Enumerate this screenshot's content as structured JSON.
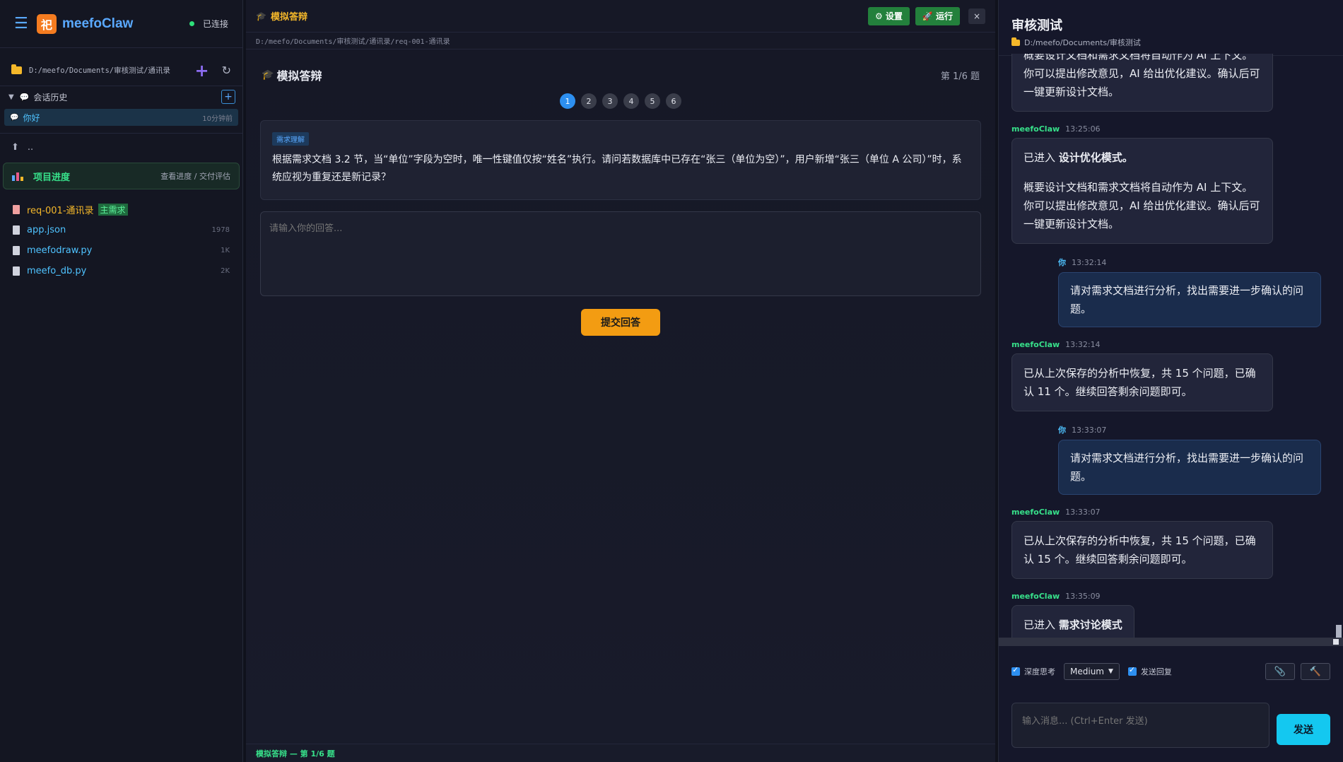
{
  "sidebar": {
    "brand": "meefoClaw",
    "logo_glyph": "祀",
    "connection_status": "已连接",
    "path": "D:/meefo/Documents/审核测试/通讯录",
    "history_label": "会话历史",
    "session": {
      "name": "你好",
      "time": "10分钟前"
    },
    "up_label": "..",
    "progress": {
      "title": "项目进度",
      "subtitle": "查看进度 / 交付评估"
    },
    "files": [
      {
        "name": "req-001-通讯录",
        "tag": "主需求",
        "size": ""
      },
      {
        "name": "app.json",
        "tag": "",
        "size": "1978"
      },
      {
        "name": "meefodraw.py",
        "tag": "",
        "size": "1K"
      },
      {
        "name": "meefo_db.py",
        "tag": "",
        "size": "2K"
      }
    ]
  },
  "center": {
    "header_title": "模拟答辩",
    "settings_label": "⚙ 设置",
    "run_label": "🚀 运行",
    "close_label": "×",
    "breadcrumb": "D:/meefo/Documents/审核测试/通讯录/req-001-通讯录",
    "question_title": "模拟答辩",
    "question_count": "第 1/6 题",
    "pages": [
      "1",
      "2",
      "3",
      "4",
      "5",
      "6"
    ],
    "question_tag": "需求理解",
    "question_text": "根据需求文档 3.2 节，当“单位”字段为空时，唯一性键值仅按“姓名”执行。请问若数据库中已存在“张三（单位为空）”，用户新增“张三（单位 A 公司）”时，系统应视为重复还是新记录？",
    "answer_placeholder": "请输入你的回答...",
    "submit_label": "提交回答",
    "footer_status": "模拟答辩 — 第 1/6 题"
  },
  "right": {
    "title": "审核测试",
    "path": "D:/meefo/Documents/审核测试",
    "messages": [
      {
        "who": "",
        "time": "",
        "text": "概要设计文档和需求文档将自动作为 AI 上下文。你可以提出修改意见，AI 给出优化建议。确认后可一键更新设计文档。"
      },
      {
        "who": "meefoClaw",
        "time": "13:25:06",
        "text_intro": "已进入 ",
        "text_bold": "设计优化模式。",
        "text": "概要设计文档和需求文档将自动作为 AI 上下文。你可以提出修改意见，AI 给出优化建议。确认后可一键更新设计文档。"
      },
      {
        "who": "你",
        "time": "13:32:14",
        "text": "请对需求文档进行分析，找出需要进一步确认的问题。"
      },
      {
        "who": "meefoClaw",
        "time": "13:32:14",
        "text": "已从上次保存的分析中恢复，共 15 个问题，已确认 11 个。继续回答剩余问题即可。"
      },
      {
        "who": "你",
        "time": "13:33:07",
        "text": "请对需求文档进行分析，找出需要进一步确认的问题。"
      },
      {
        "who": "meefoClaw",
        "time": "13:33:07",
        "text": "已从上次保存的分析中恢复，共 15 个问题，已确认 15 个。继续回答剩余问题即可。"
      },
      {
        "who": "meefoClaw",
        "time": "13:35:09",
        "text_intro": "已进入 ",
        "text_bold": "需求讨论模式"
      }
    ],
    "deep_think_label": "深度思考",
    "effort_value": "Medium",
    "send_reply_label": "发送回复",
    "input_placeholder": "输入消息... (Ctrl+Enter 发送)",
    "send_label": "发送"
  }
}
